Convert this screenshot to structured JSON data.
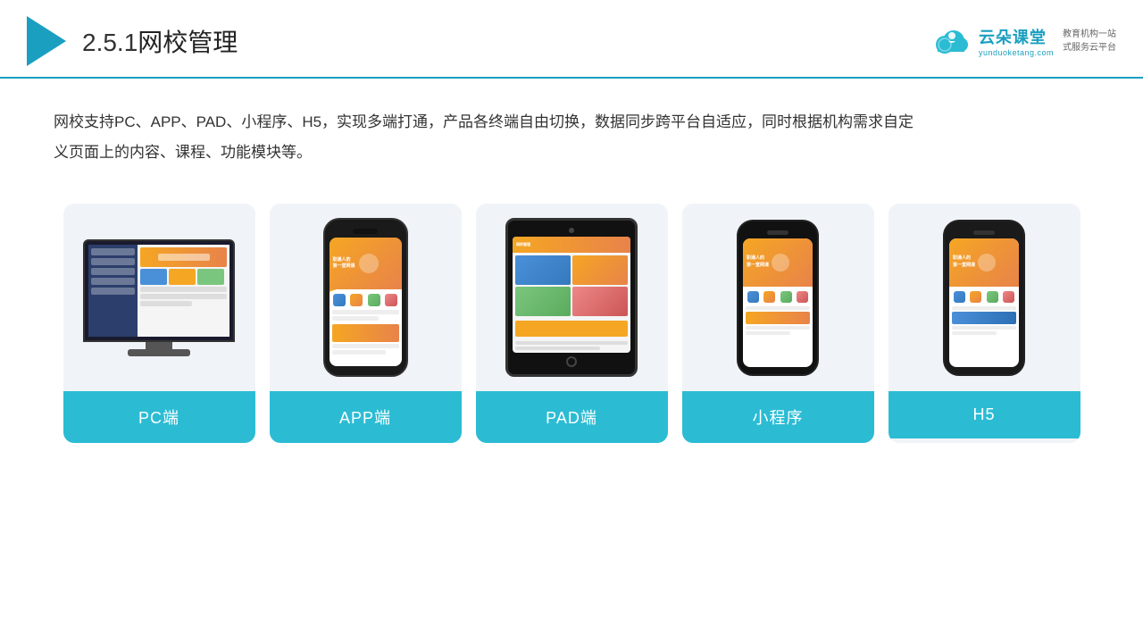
{
  "header": {
    "title": "网校管理",
    "section_num": "2.5.1",
    "brand": {
      "name": "云朵课堂",
      "url": "yunduoketang.com",
      "tagline": "教育机构一站\n式服务云平台"
    }
  },
  "description": {
    "text": "网校支持PC、APP、PAD、小程序、H5，实现多端打通，产品各终端自由切换，数据同步跨平台自适应，同时根据机构需求自定义页面上的内容、课程、功能模块等。"
  },
  "cards": [
    {
      "id": "pc",
      "label": "PC端"
    },
    {
      "id": "app",
      "label": "APP端"
    },
    {
      "id": "pad",
      "label": "PAD端"
    },
    {
      "id": "miniprogram",
      "label": "小程序"
    },
    {
      "id": "h5",
      "label": "H5"
    }
  ],
  "colors": {
    "accent": "#2bbcd4",
    "header_line": "#1a9fc0",
    "triangle": "#1a9fc0",
    "card_bg": "#eef2f7",
    "label_bg": "#2bbcd4",
    "label_text": "#ffffff"
  }
}
